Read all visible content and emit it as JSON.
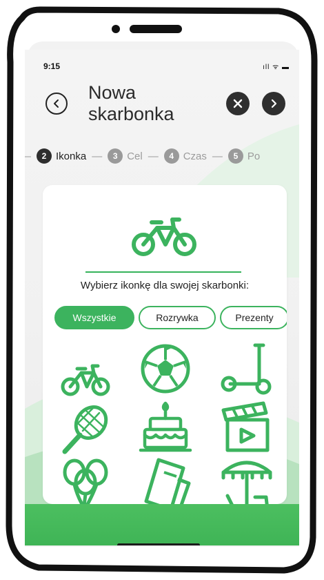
{
  "status": {
    "time": "9:15",
    "icons": "ıll ᯤ ▬"
  },
  "header": {
    "title_line1": "Nowa",
    "title_line2": "skarbonka"
  },
  "steps": [
    {
      "num": "2",
      "label": "Ikonka"
    },
    {
      "num": "3",
      "label": "Cel"
    },
    {
      "num": "4",
      "label": "Czas"
    },
    {
      "num": "5",
      "label": "Po"
    }
  ],
  "steps_separator": "—",
  "card": {
    "prompt": "Wybierz ikonkę dla swojej skarbonki:"
  },
  "categories": [
    "Wszystkie",
    "Rozrywka",
    "Prezenty"
  ],
  "selected_category": "Wszystkie",
  "icons": [
    "bicycle-icon",
    "soccer-ball-icon",
    "scooter-icon",
    "tennis-racket-icon",
    "birthday-cake-icon",
    "film-clapper-icon",
    "balloons-icon",
    "tickets-icon",
    "beach-umbrella-icon"
  ],
  "colors": {
    "accent": "#3cb35e",
    "dark": "#2f2f2f"
  }
}
